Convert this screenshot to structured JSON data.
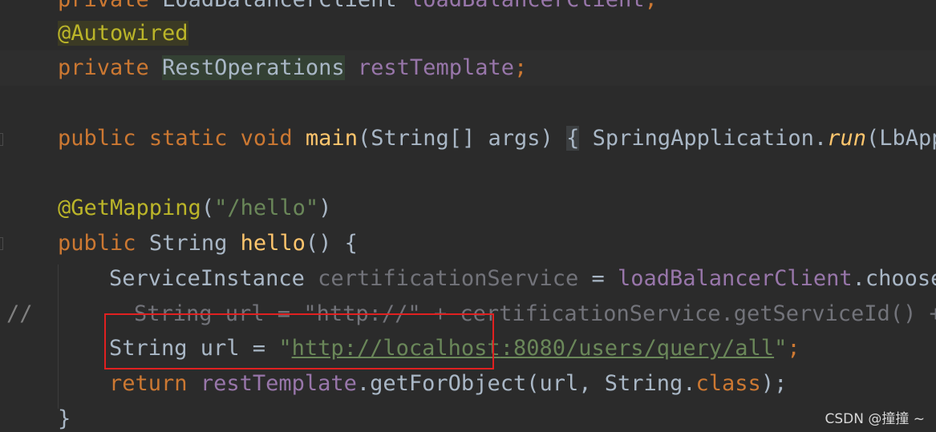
{
  "code": {
    "line0": {
      "private": "private",
      "type": "LoadBalancerClient",
      "name": "loadBalancerClient",
      "semi": ";"
    },
    "line1": {
      "annotation": "@Autowired"
    },
    "line2": {
      "private": "private",
      "type": "RestOperations",
      "name": "restTemplate",
      "semi": ";"
    },
    "line4": {
      "public": "public",
      "static": "static",
      "void": "void",
      "method": "main",
      "params_open": "(String[] args)",
      "brace": "{",
      "body": "SpringApplication.",
      "run": "run",
      "rest": "(LbAppl"
    },
    "line6": {
      "annotation": "@GetMapping",
      "paren_open": "(",
      "string": "\"/hello\"",
      "paren_close": ")"
    },
    "line7": {
      "public": "public",
      "type": "String",
      "method": "hello",
      "rest": "() {"
    },
    "line8": {
      "type": "ServiceInstance",
      "var": "certificationService",
      "eq": " = ",
      "field": "loadBalancerClient",
      "call": ".choose("
    },
    "line9": {
      "comment_prefix": "//",
      "text": "String url = \"http://\" + certificationService.getServiceId() + "
    },
    "line10": {
      "decl": "String url = ",
      "quote_open": "\"",
      "link": "http://localhost",
      "link_rest": ":8080/users/query/all",
      "quote_close": "\"",
      "semi": ";"
    },
    "line11": {
      "return": "return",
      "field": "restTemplate",
      "call": ".getForObject(url, String.",
      "class": "class",
      "close": ");"
    },
    "line12": {
      "brace": "}"
    }
  },
  "watermark": "CSDN @撞撞 ~"
}
